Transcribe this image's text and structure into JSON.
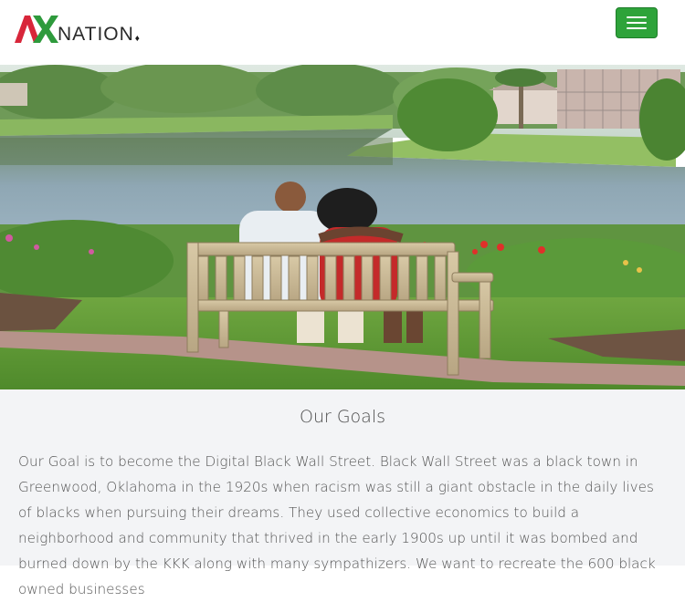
{
  "header": {
    "logo": {
      "mark_text": "AX",
      "wordmark": "NATION",
      "mark_colors": {
        "a": "#d8263a",
        "x": "#2e9a3c"
      }
    },
    "menu_button_icon": "hamburger-icon",
    "menu_button_color": "#2ea33a"
  },
  "hero": {
    "image": "couple-on-bench-by-lake-photo"
  },
  "goals": {
    "title": "Our Goals",
    "body": "Our Goal is to become the Digital Black Wall Street. Black Wall Street was a black town in Greenwood, Oklahoma in the 1920s when racism was still a giant obstacle in the daily lives of blacks when pursuing their dreams. They used collective economics to build a neighborhood and community that thrived in the early 1900s up until it was bombed and burned down by the KKK along with many sympathizers. We want to recreate the 600 black owned businesses"
  }
}
